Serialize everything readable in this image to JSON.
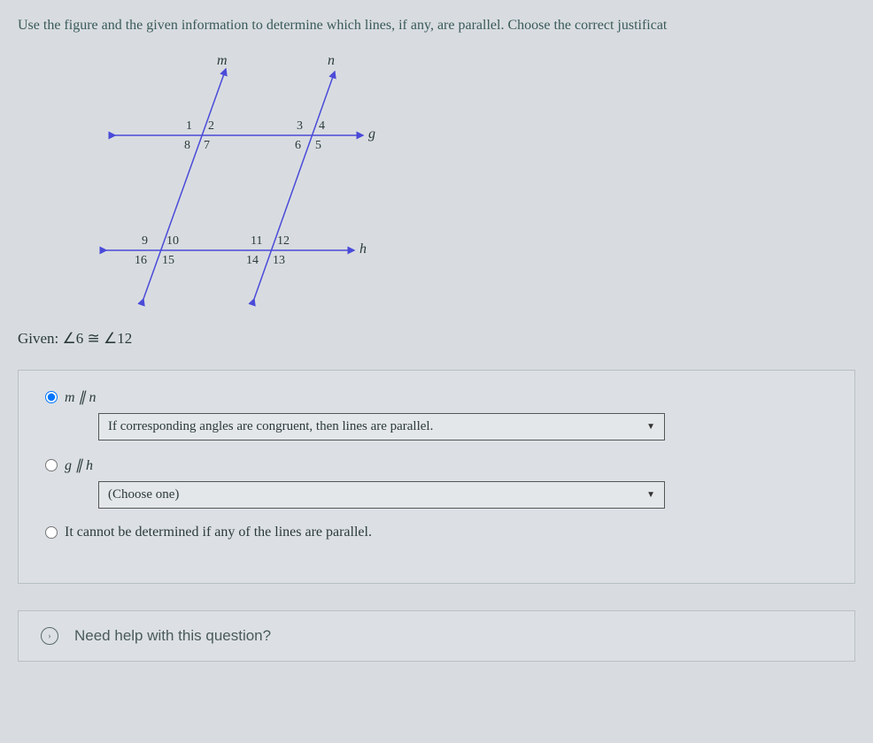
{
  "question": "Use the figure and the given information to determine which lines, if any, are parallel. Choose the correct justificat",
  "figure": {
    "lines": {
      "m": "m",
      "n": "n",
      "g": "g",
      "h": "h"
    },
    "angles": {
      "top_g": {
        "a1": "1",
        "a2": "2",
        "a8": "8",
        "a7": "7",
        "a3": "3",
        "a4": "4",
        "a6": "6",
        "a5": "5"
      },
      "bot_h": {
        "a9": "9",
        "a10": "10",
        "a16": "16",
        "a15": "15",
        "a11": "11",
        "a12": "12",
        "a14": "14",
        "a13": "13"
      }
    }
  },
  "given": "Given: ∠6 ≅ ∠12",
  "options": {
    "opt1": {
      "label": "m ∥ n",
      "selected": true
    },
    "opt1_justification": "If corresponding angles are congruent, then lines are parallel.",
    "opt2": {
      "label": "g ∥ h",
      "selected": false
    },
    "opt2_justification": "(Choose one)",
    "opt3": {
      "label": "It cannot be determined if any of the lines are parallel.",
      "selected": false
    }
  },
  "buttons": {
    "close": "×"
  },
  "help": {
    "text": "Need help with this question?"
  }
}
